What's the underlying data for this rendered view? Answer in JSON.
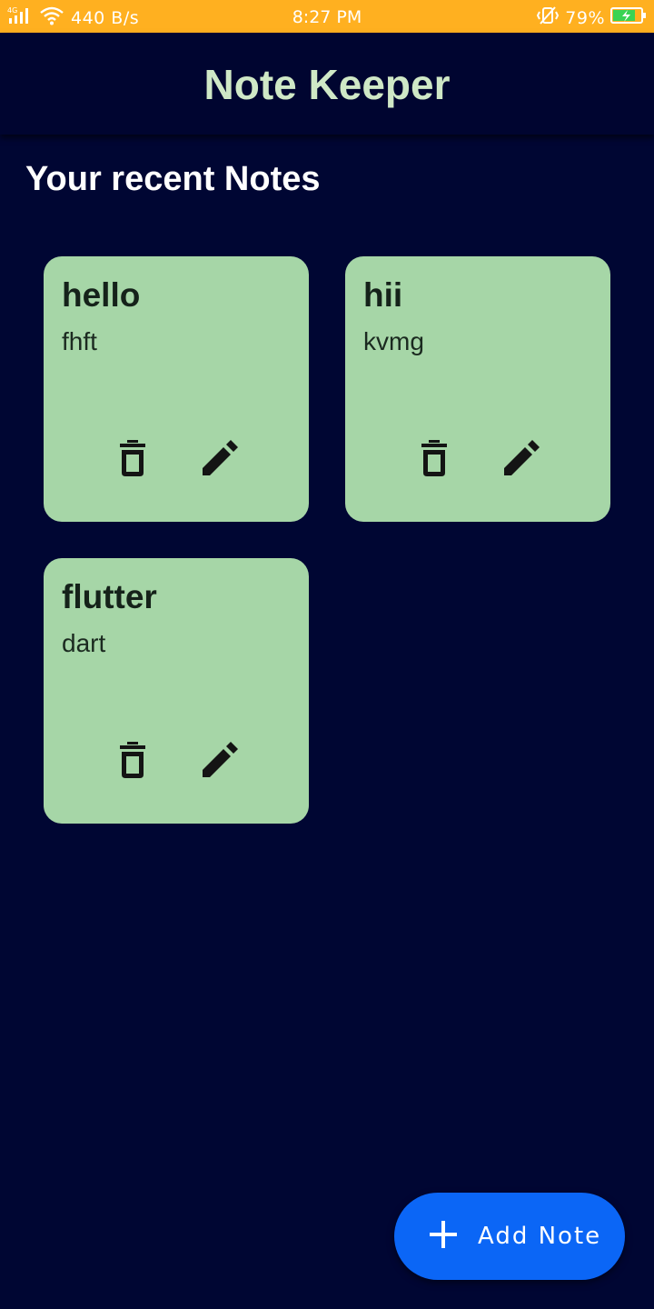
{
  "status_bar": {
    "network": "4G",
    "speed": "440 B/s",
    "time": "8:27 PM",
    "battery": "79%"
  },
  "app_bar": {
    "title": "Note Keeper"
  },
  "section_title": "Your recent Notes",
  "notes": [
    {
      "title": "hello",
      "body": "fhft"
    },
    {
      "title": "hii",
      "body": "kvmg"
    },
    {
      "title": "flutter",
      "body": "dart"
    }
  ],
  "fab": {
    "label": "Add Note"
  },
  "colors": {
    "background": "#000633",
    "status_bar": "#ffb020",
    "title": "#cfe8c6",
    "card": "#a6d6a7",
    "fab": "#0b66f6"
  }
}
